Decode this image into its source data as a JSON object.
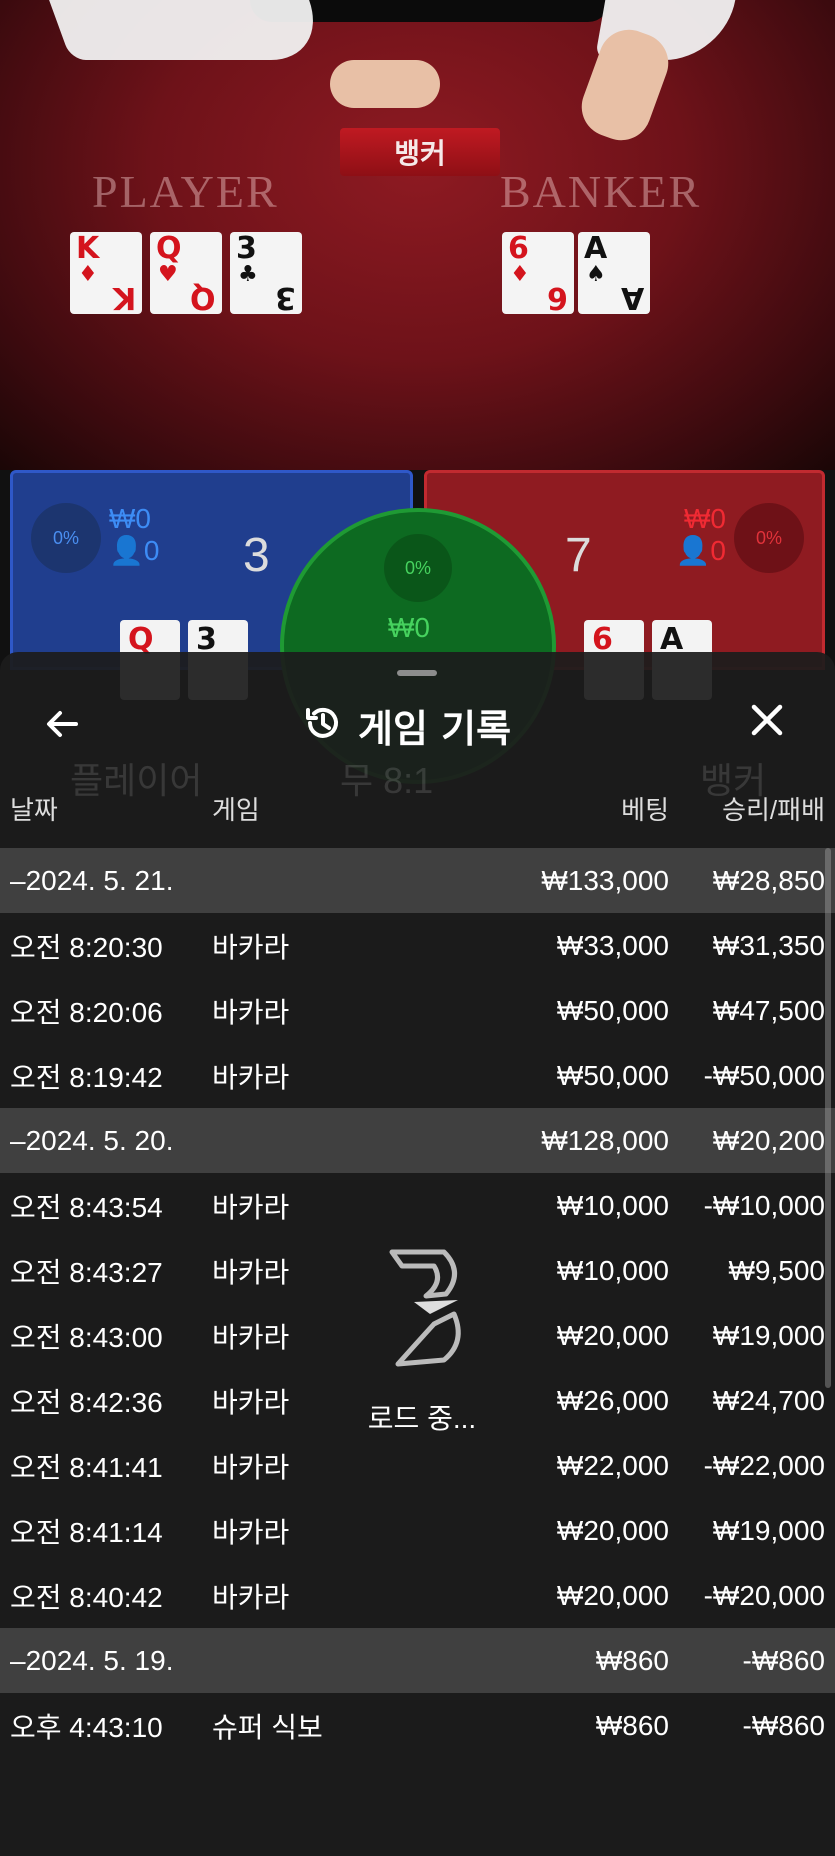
{
  "table": {
    "result_banner": "뱅커",
    "player_label": "PLAYER",
    "banker_label": "BANKER",
    "player_cards": [
      {
        "rank": "K",
        "suit": "♦",
        "color": "red"
      },
      {
        "rank": "Q",
        "suit": "♥",
        "color": "red"
      },
      {
        "rank": "3",
        "suit": "♣",
        "color": "black"
      }
    ],
    "banker_cards": [
      {
        "rank": "6",
        "suit": "♦",
        "color": "red"
      },
      {
        "rank": "A",
        "suit": "♠",
        "color": "black"
      }
    ]
  },
  "bet_panels": {
    "player": {
      "percent": "0%",
      "amount": "₩0",
      "users": "0",
      "score": "3"
    },
    "tie": {
      "percent": "0%",
      "amount": "₩0"
    },
    "banker": {
      "percent": "0%",
      "amount": "₩0",
      "users": "0",
      "score": "7"
    }
  },
  "sheet": {
    "title": "게임 기록",
    "columns": {
      "date": "날짜",
      "game": "게임",
      "bet": "베팅",
      "result": "승리/패배"
    },
    "loading_text": "로드 중...",
    "rows": [
      {
        "type": "group",
        "date": "–2024. 5. 21.",
        "game": "",
        "bet": "₩133,000",
        "result": "₩28,850"
      },
      {
        "type": "item",
        "date": "오전 8:20:30",
        "game": "바카라",
        "bet": "₩33,000",
        "result": "₩31,350"
      },
      {
        "type": "item",
        "date": "오전 8:20:06",
        "game": "바카라",
        "bet": "₩50,000",
        "result": "₩47,500"
      },
      {
        "type": "item",
        "date": "오전 8:19:42",
        "game": "바카라",
        "bet": "₩50,000",
        "result": "-₩50,000"
      },
      {
        "type": "group",
        "date": "–2024. 5. 20.",
        "game": "",
        "bet": "₩128,000",
        "result": "₩20,200"
      },
      {
        "type": "item",
        "date": "오전 8:43:54",
        "game": "바카라",
        "bet": "₩10,000",
        "result": "-₩10,000"
      },
      {
        "type": "item",
        "date": "오전 8:43:27",
        "game": "바카라",
        "bet": "₩10,000",
        "result": "₩9,500"
      },
      {
        "type": "item",
        "date": "오전 8:43:00",
        "game": "바카라",
        "bet": "₩20,000",
        "result": "₩19,000"
      },
      {
        "type": "item",
        "date": "오전 8:42:36",
        "game": "바카라",
        "bet": "₩26,000",
        "result": "₩24,700"
      },
      {
        "type": "item",
        "date": "오전 8:41:41",
        "game": "바카라",
        "bet": "₩22,000",
        "result": "-₩22,000"
      },
      {
        "type": "item",
        "date": "오전 8:41:14",
        "game": "바카라",
        "bet": "₩20,000",
        "result": "₩19,000"
      },
      {
        "type": "item",
        "date": "오전 8:40:42",
        "game": "바카라",
        "bet": "₩20,000",
        "result": "-₩20,000"
      },
      {
        "type": "group",
        "date": "–2024. 5. 19.",
        "game": "",
        "bet": "₩860",
        "result": "-₩860"
      },
      {
        "type": "item",
        "date": "오후 4:43:10",
        "game": "슈퍼 식보",
        "bet": "₩860",
        "result": "-₩860"
      }
    ]
  }
}
